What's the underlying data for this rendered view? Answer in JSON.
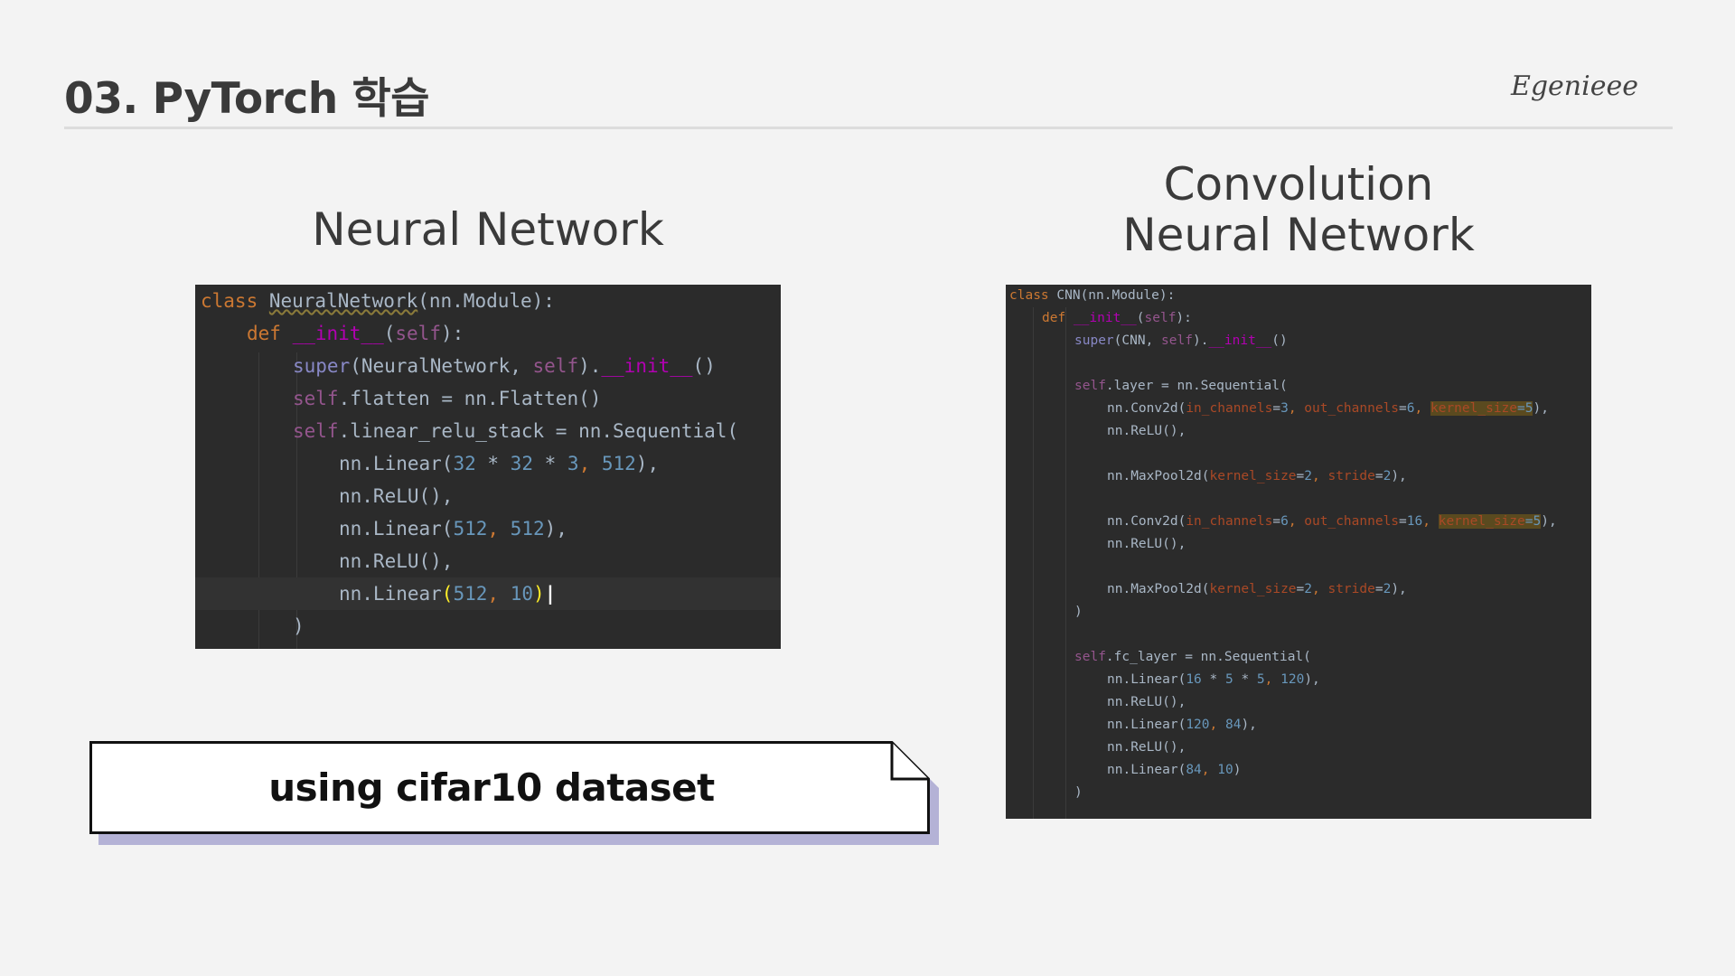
{
  "header": {
    "title": "03. PyTorch 학습",
    "brand": "Egenieee"
  },
  "left": {
    "heading": "Neural Network",
    "code": [
      {
        "indent": 0,
        "parts": [
          {
            "t": "class ",
            "c": "kw"
          },
          {
            "t": "NeuralNetwork",
            "c": "name"
          },
          {
            "t": "(nn.Module):",
            "c": "txt"
          }
        ]
      },
      {
        "indent": 1,
        "parts": [
          {
            "t": "def ",
            "c": "kw"
          },
          {
            "t": "__init__",
            "c": "magic"
          },
          {
            "t": "(",
            "c": "txt"
          },
          {
            "t": "self",
            "c": "self"
          },
          {
            "t": "):",
            "c": "txt"
          }
        ]
      },
      {
        "indent": 2,
        "parts": [
          {
            "t": "super",
            "c": "builtin"
          },
          {
            "t": "(NeuralNetwork, ",
            "c": "txt"
          },
          {
            "t": "self",
            "c": "self"
          },
          {
            "t": ").",
            "c": "txt"
          },
          {
            "t": "__init__",
            "c": "magic"
          },
          {
            "t": "()",
            "c": "txt"
          }
        ]
      },
      {
        "indent": 2,
        "parts": [
          {
            "t": "self",
            "c": "self"
          },
          {
            "t": ".flatten = nn.Flatten()",
            "c": "txt"
          }
        ]
      },
      {
        "indent": 2,
        "parts": [
          {
            "t": "self",
            "c": "self"
          },
          {
            "t": ".linear_relu_stack = nn.Sequential(",
            "c": "txt"
          }
        ]
      },
      {
        "indent": 3,
        "parts": [
          {
            "t": "nn.Linear(",
            "c": "txt"
          },
          {
            "t": "32",
            "c": "num"
          },
          {
            "t": " * ",
            "c": "txt"
          },
          {
            "t": "32",
            "c": "num"
          },
          {
            "t": " * ",
            "c": "txt"
          },
          {
            "t": "3",
            "c": "num"
          },
          {
            "t": ", ",
            "c": "punc"
          },
          {
            "t": "512",
            "c": "num"
          },
          {
            "t": "),",
            "c": "txt"
          }
        ]
      },
      {
        "indent": 3,
        "parts": [
          {
            "t": "nn.ReLU(),",
            "c": "txt"
          }
        ]
      },
      {
        "indent": 3,
        "parts": [
          {
            "t": "nn.Linear(",
            "c": "txt"
          },
          {
            "t": "512",
            "c": "num"
          },
          {
            "t": ", ",
            "c": "punc"
          },
          {
            "t": "512",
            "c": "num"
          },
          {
            "t": "),",
            "c": "txt"
          }
        ]
      },
      {
        "indent": 3,
        "parts": [
          {
            "t": "nn.ReLU(),",
            "c": "txt"
          }
        ]
      },
      {
        "indent": 3,
        "current": true,
        "parts": [
          {
            "t": "nn.Linear",
            "c": "txt"
          },
          {
            "t": "(",
            "c": "bracket"
          },
          {
            "t": "512",
            "c": "num"
          },
          {
            "t": ", ",
            "c": "punc"
          },
          {
            "t": "10",
            "c": "num"
          },
          {
            "t": ")",
            "c": "bracket"
          },
          {
            "t": "|",
            "c": "caret"
          }
        ]
      },
      {
        "indent": 2,
        "parts": [
          {
            "t": ")",
            "c": "txt"
          }
        ]
      }
    ]
  },
  "right": {
    "heading_line1": "Convolution",
    "heading_line2": "Neural Network",
    "code": [
      {
        "indent": 0,
        "parts": [
          {
            "t": "class ",
            "c": "kw"
          },
          {
            "t": "CNN(nn.Module):",
            "c": "txt"
          }
        ]
      },
      {
        "indent": 1,
        "parts": [
          {
            "t": "def ",
            "c": "kw"
          },
          {
            "t": "__init__",
            "c": "magic"
          },
          {
            "t": "(",
            "c": "txt"
          },
          {
            "t": "self",
            "c": "self"
          },
          {
            "t": "):",
            "c": "txt"
          }
        ]
      },
      {
        "indent": 2,
        "parts": [
          {
            "t": "super",
            "c": "builtin"
          },
          {
            "t": "(CNN, ",
            "c": "txt"
          },
          {
            "t": "self",
            "c": "self"
          },
          {
            "t": ").",
            "c": "txt"
          },
          {
            "t": "__init__",
            "c": "magic"
          },
          {
            "t": "()",
            "c": "txt"
          }
        ]
      },
      {
        "indent": 0,
        "parts": []
      },
      {
        "indent": 2,
        "parts": [
          {
            "t": "self",
            "c": "self"
          },
          {
            "t": ".layer = nn.Sequential(",
            "c": "txt"
          }
        ]
      },
      {
        "indent": 3,
        "parts": [
          {
            "t": "nn.Conv2d(",
            "c": "txt"
          },
          {
            "t": "in_channels",
            "c": "param"
          },
          {
            "t": "=",
            "c": "txt"
          },
          {
            "t": "3",
            "c": "num"
          },
          {
            "t": ", ",
            "c": "punc"
          },
          {
            "t": "out_channels",
            "c": "param"
          },
          {
            "t": "=",
            "c": "txt"
          },
          {
            "t": "6",
            "c": "num"
          },
          {
            "t": ", ",
            "c": "punc"
          },
          {
            "t": "kernel_size",
            "c": "param-hl"
          },
          {
            "t": "=5",
            "c": "num-hl"
          },
          {
            "t": "),",
            "c": "txt"
          }
        ]
      },
      {
        "indent": 3,
        "parts": [
          {
            "t": "nn.ReLU(),",
            "c": "txt"
          }
        ]
      },
      {
        "indent": 0,
        "parts": []
      },
      {
        "indent": 3,
        "parts": [
          {
            "t": "nn.MaxPool2d(",
            "c": "txt"
          },
          {
            "t": "kernel_size",
            "c": "param"
          },
          {
            "t": "=",
            "c": "txt"
          },
          {
            "t": "2",
            "c": "num"
          },
          {
            "t": ", ",
            "c": "punc"
          },
          {
            "t": "stride",
            "c": "param"
          },
          {
            "t": "=",
            "c": "txt"
          },
          {
            "t": "2",
            "c": "num"
          },
          {
            "t": "),",
            "c": "txt"
          }
        ]
      },
      {
        "indent": 0,
        "parts": []
      },
      {
        "indent": 3,
        "parts": [
          {
            "t": "nn.Conv2d(",
            "c": "txt"
          },
          {
            "t": "in_channels",
            "c": "param"
          },
          {
            "t": "=",
            "c": "txt"
          },
          {
            "t": "6",
            "c": "num"
          },
          {
            "t": ", ",
            "c": "punc"
          },
          {
            "t": "out_channels",
            "c": "param"
          },
          {
            "t": "=",
            "c": "txt"
          },
          {
            "t": "16",
            "c": "num"
          },
          {
            "t": ", ",
            "c": "punc"
          },
          {
            "t": "kernel_size",
            "c": "param-hl"
          },
          {
            "t": "=5",
            "c": "num-hl"
          },
          {
            "t": "),",
            "c": "txt"
          }
        ]
      },
      {
        "indent": 3,
        "parts": [
          {
            "t": "nn.ReLU(),",
            "c": "txt"
          }
        ]
      },
      {
        "indent": 0,
        "parts": []
      },
      {
        "indent": 3,
        "parts": [
          {
            "t": "nn.MaxPool2d(",
            "c": "txt"
          },
          {
            "t": "kernel_size",
            "c": "param"
          },
          {
            "t": "=",
            "c": "txt"
          },
          {
            "t": "2",
            "c": "num"
          },
          {
            "t": ", ",
            "c": "punc"
          },
          {
            "t": "stride",
            "c": "param"
          },
          {
            "t": "=",
            "c": "txt"
          },
          {
            "t": "2",
            "c": "num"
          },
          {
            "t": "),",
            "c": "txt"
          }
        ]
      },
      {
        "indent": 2,
        "parts": [
          {
            "t": ")",
            "c": "txt"
          }
        ]
      },
      {
        "indent": 0,
        "parts": []
      },
      {
        "indent": 2,
        "parts": [
          {
            "t": "self",
            "c": "self"
          },
          {
            "t": ".fc_layer = nn.Sequential(",
            "c": "txt"
          }
        ]
      },
      {
        "indent": 3,
        "parts": [
          {
            "t": "nn.Linear(",
            "c": "txt"
          },
          {
            "t": "16",
            "c": "num"
          },
          {
            "t": " * ",
            "c": "txt"
          },
          {
            "t": "5",
            "c": "num"
          },
          {
            "t": " * ",
            "c": "txt"
          },
          {
            "t": "5",
            "c": "num"
          },
          {
            "t": ", ",
            "c": "punc"
          },
          {
            "t": "120",
            "c": "num"
          },
          {
            "t": "),",
            "c": "txt"
          }
        ]
      },
      {
        "indent": 3,
        "parts": [
          {
            "t": "nn.ReLU(),",
            "c": "txt"
          }
        ]
      },
      {
        "indent": 3,
        "parts": [
          {
            "t": "nn.Linear(",
            "c": "txt"
          },
          {
            "t": "120",
            "c": "num"
          },
          {
            "t": ", ",
            "c": "punc"
          },
          {
            "t": "84",
            "c": "num"
          },
          {
            "t": "),",
            "c": "txt"
          }
        ]
      },
      {
        "indent": 3,
        "parts": [
          {
            "t": "nn.ReLU(),",
            "c": "txt"
          }
        ]
      },
      {
        "indent": 3,
        "parts": [
          {
            "t": "nn.Linear(",
            "c": "txt"
          },
          {
            "t": "84",
            "c": "num"
          },
          {
            "t": ", ",
            "c": "punc"
          },
          {
            "t": "10",
            "c": "num"
          },
          {
            "t": ")",
            "c": "txt"
          }
        ]
      },
      {
        "indent": 2,
        "parts": [
          {
            "t": ")",
            "c": "txt"
          }
        ]
      }
    ]
  },
  "callout": {
    "text": "using cifar10 dataset"
  },
  "colors": {
    "kw": "#cc7832",
    "txt": "#a9b7c6",
    "name": "#a9b7c6",
    "magic": "#b200b2",
    "self": "#94558d",
    "builtin": "#8888c6",
    "num": "#6897bb",
    "punc": "#cc7832",
    "param": "#aa4926",
    "bracket": "#ffef28",
    "caret": "#ffffff",
    "highlight_bg": "#5a4a1f",
    "accent_shadow": "#b4b2d6"
  }
}
